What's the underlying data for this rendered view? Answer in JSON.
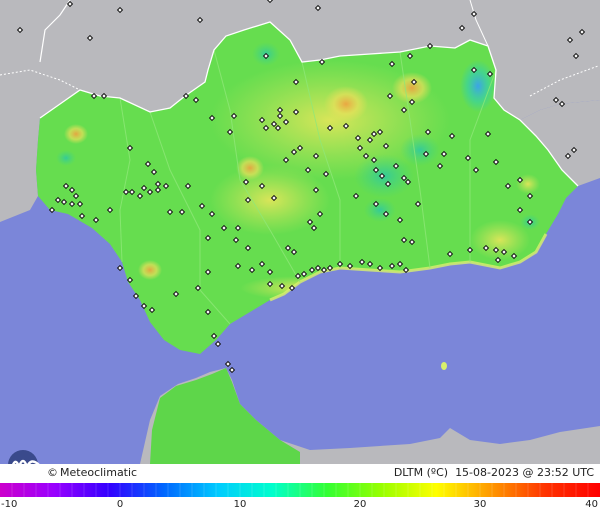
{
  "brand": {
    "copyright": "©",
    "name": "Meteoclimatic"
  },
  "caption": {
    "variable": "DLTM (ºC)",
    "date": "15-08-2023",
    "time": "@ 23:52 UTC"
  },
  "legend": {
    "min": -10,
    "max": 40,
    "ticks": [
      "-10",
      "0",
      "10",
      "20",
      "30",
      "40"
    ],
    "tick_values": [
      -10,
      0,
      10,
      20,
      30,
      40
    ]
  },
  "colors": {
    "sea": "#7b86d9",
    "land_outside": "#b9b9bd",
    "region_base": "#66dd4f",
    "border": "#ffffff",
    "station": "#111111",
    "coast_glow": "#d9f06b"
  },
  "scale_colors": [
    "#cc00cc",
    "#9900ff",
    "#3300ff",
    "#0066ff",
    "#00ccff",
    "#00ffcc",
    "#33ff33",
    "#99ff00",
    "#ffff00",
    "#ff9900",
    "#ff3300",
    "#ff0000"
  ]
}
